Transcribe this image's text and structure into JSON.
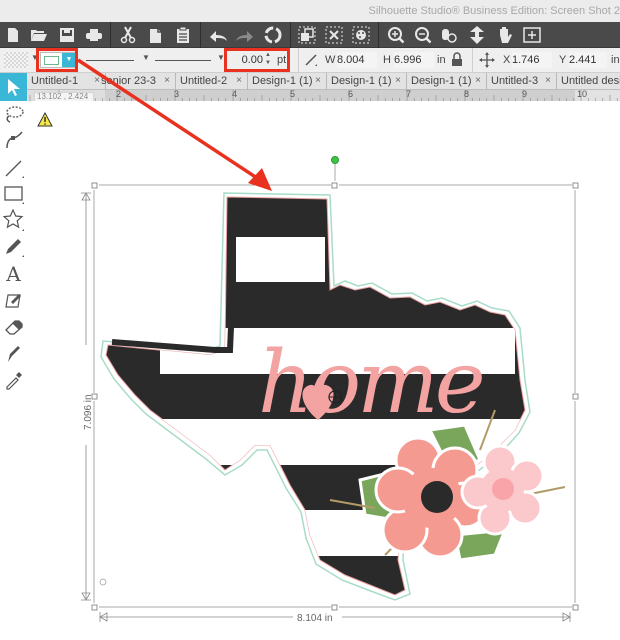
{
  "window": {
    "title": "Silhouette Studio® Business Edition: Screen Shot 2"
  },
  "toolbar": {
    "groups": [
      [
        "new-document",
        "open-folder",
        "save",
        "print"
      ],
      [
        "cut",
        "copy",
        "paste"
      ],
      [
        "undo",
        "redo",
        "redraw"
      ],
      [
        "group",
        "ungroup",
        "fill-pattern"
      ],
      [
        "zoom-in",
        "zoom-out",
        "zoom-selected",
        "move-down",
        "pan-hand",
        "fit-page"
      ]
    ]
  },
  "properties": {
    "line_color": "#ffffff",
    "line_color_border": "#6db88c",
    "line_style_1": "",
    "line_style_2": "",
    "line_weight": "0.00",
    "line_weight_unit": "pt",
    "width_label": "W",
    "width_value": "8.004",
    "height_label": "H",
    "height_value": "6.996",
    "size_unit": "in",
    "x_label": "X",
    "x_value": "1.746",
    "y_label": "Y",
    "y_value": "2.441",
    "pos_unit": "in"
  },
  "tabs": [
    {
      "label": "Untitled-1"
    },
    {
      "label": "senior 23-3"
    },
    {
      "label": "Untitled-2"
    },
    {
      "label": "Design-1 (1)"
    },
    {
      "label": "Design-1 (1)"
    },
    {
      "label": "Design-1 (1)"
    },
    {
      "label": "Untitled-3"
    },
    {
      "label": "Untitled design"
    }
  ],
  "tab_close": "×",
  "ruler": {
    "coord_readout": "13.102 , 2.424",
    "numbers": [
      "2",
      "3",
      "4",
      "5",
      "6",
      "7",
      "8",
      "9",
      "10"
    ]
  },
  "tools": [
    "select",
    "point-edit",
    "bezier",
    "line",
    "rectangle",
    "star",
    "pencil",
    "text",
    "knife",
    "eraser",
    "knife-pen",
    "eyedropper"
  ],
  "selection": {
    "width_dim": "8.104 in",
    "height_dim": "7.096 in"
  },
  "design": {
    "word": "home",
    "colors": {
      "stripe_black": "#2a2a2a",
      "pink": "#f4a3a3",
      "light_pink": "#fbc8cc",
      "green": "#7aa65c",
      "gold": "#b39b68",
      "cut_line": "#e9a0a0"
    }
  },
  "annotation": {
    "arrow_color": "#e8321f"
  }
}
